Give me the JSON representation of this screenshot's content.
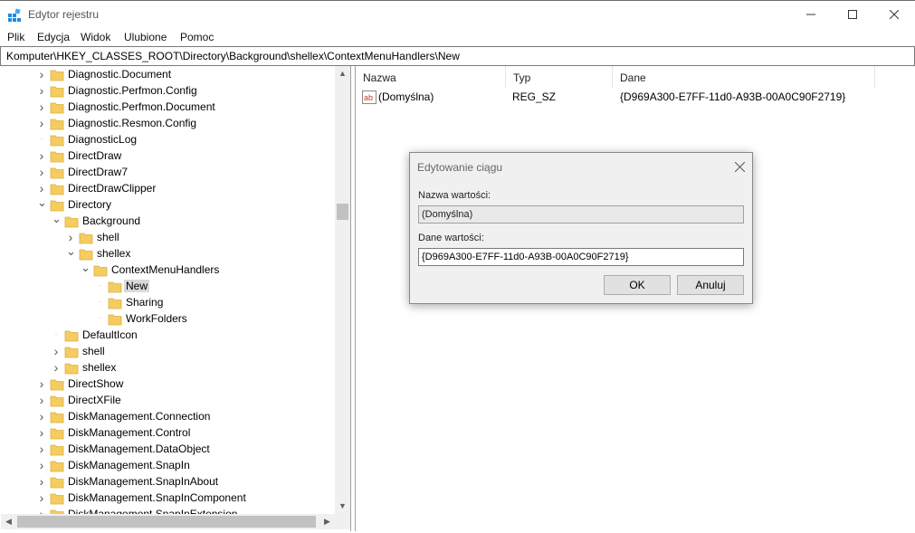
{
  "window": {
    "title": "Edytor rejestru",
    "icon": "registry-editor-icon",
    "controls": [
      "minimize-icon",
      "maximize-icon",
      "close-icon"
    ]
  },
  "menu": [
    "Plik",
    "Edycja",
    "Widok",
    "Ulubione",
    "Pomoc"
  ],
  "address": "Komputer\\HKEY_CLASSES_ROOT\\Directory\\Background\\shellex\\ContextMenuHandlers\\New",
  "tree": {
    "items": [
      {
        "label": "Diagnostic.Document",
        "level": 0,
        "expander": "collapsed"
      },
      {
        "label": "Diagnostic.Perfmon.Config",
        "level": 0,
        "expander": "collapsed"
      },
      {
        "label": "Diagnostic.Perfmon.Document",
        "level": 0,
        "expander": "collapsed"
      },
      {
        "label": "Diagnostic.Resmon.Config",
        "level": 0,
        "expander": "collapsed"
      },
      {
        "label": "DiagnosticLog",
        "level": 0,
        "expander": "none"
      },
      {
        "label": "DirectDraw",
        "level": 0,
        "expander": "collapsed"
      },
      {
        "label": "DirectDraw7",
        "level": 0,
        "expander": "collapsed"
      },
      {
        "label": "DirectDrawClipper",
        "level": 0,
        "expander": "collapsed"
      },
      {
        "label": "Directory",
        "level": 0,
        "expander": "expanded"
      },
      {
        "label": "Background",
        "level": 1,
        "expander": "expanded"
      },
      {
        "label": "shell",
        "level": 2,
        "expander": "collapsed"
      },
      {
        "label": "shellex",
        "level": 2,
        "expander": "expanded"
      },
      {
        "label": "ContextMenuHandlers",
        "level": 3,
        "expander": "expanded"
      },
      {
        "label": "New",
        "level": 4,
        "expander": "none",
        "selected": true
      },
      {
        "label": "Sharing",
        "level": 4,
        "expander": "none"
      },
      {
        "label": "WorkFolders",
        "level": 4,
        "expander": "none"
      },
      {
        "label": "DefaultIcon",
        "level": 1,
        "expander": "none"
      },
      {
        "label": "shell",
        "level": 1,
        "expander": "collapsed"
      },
      {
        "label": "shellex",
        "level": 1,
        "expander": "collapsed"
      },
      {
        "label": "DirectShow",
        "level": 0,
        "expander": "collapsed"
      },
      {
        "label": "DirectXFile",
        "level": 0,
        "expander": "collapsed"
      },
      {
        "label": "DiskManagement.Connection",
        "level": 0,
        "expander": "collapsed"
      },
      {
        "label": "DiskManagement.Control",
        "level": 0,
        "expander": "collapsed"
      },
      {
        "label": "DiskManagement.DataObject",
        "level": 0,
        "expander": "collapsed"
      },
      {
        "label": "DiskManagement.SnapIn",
        "level": 0,
        "expander": "collapsed"
      },
      {
        "label": "DiskManagement.SnapInAbout",
        "level": 0,
        "expander": "collapsed"
      },
      {
        "label": "DiskManagement.SnapInComponent",
        "level": 0,
        "expander": "collapsed"
      },
      {
        "label": "DiskManagement.SnapInExtension",
        "level": 0,
        "expander": "collapsed"
      }
    ]
  },
  "list": {
    "columns": [
      "Nazwa",
      "Typ",
      "Dane"
    ],
    "rows": [
      {
        "icon": "string-value-icon",
        "name": "(Domyślna)",
        "type": "REG_SZ",
        "data": "{D969A300-E7FF-11d0-A93B-00A0C90F2719}"
      }
    ]
  },
  "dialog": {
    "title": "Edytowanie ciągu",
    "name_label": "Nazwa wartości:",
    "name_value": "(Domyślna)",
    "data_label": "Dane wartości:",
    "data_value": "{D969A300-E7FF-11d0-A93B-00A0C90F2719}",
    "ok": "OK",
    "cancel": "Anuluj"
  },
  "colors": {
    "folder": "#f4cc60",
    "folder_dark": "#dcb040",
    "selection": "#d9d9d9",
    "dialog_bg": "#f0f0f0"
  }
}
